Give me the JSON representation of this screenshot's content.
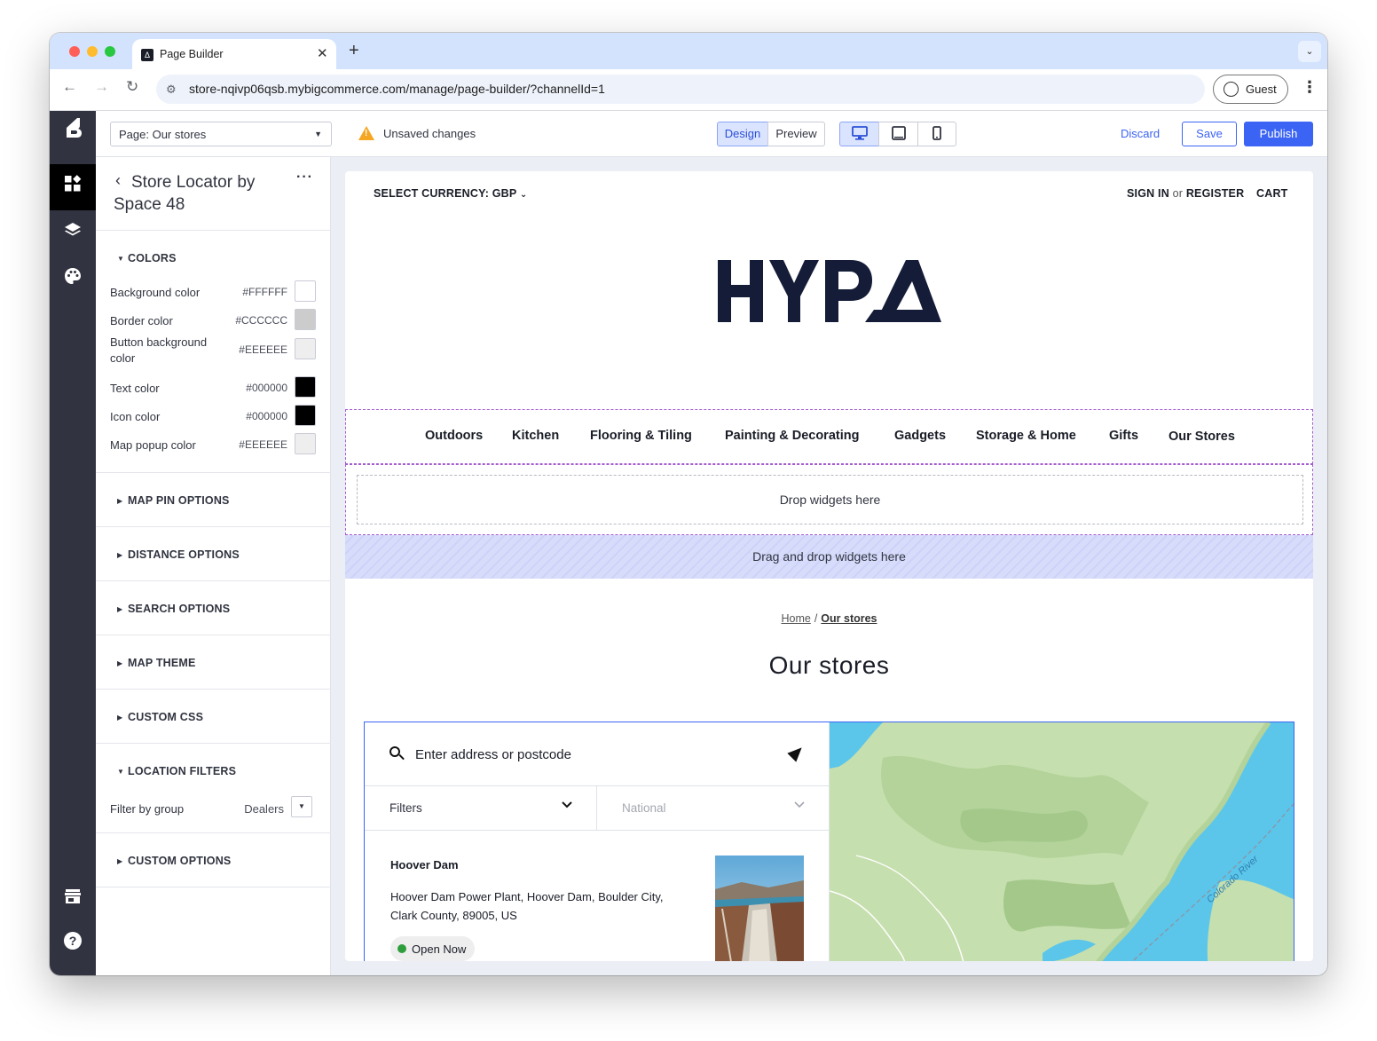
{
  "browser": {
    "tab_title": "Page Builder",
    "tab_favicon": "Δ",
    "url": "store-nqivp06qsb.mybigcommerce.com/manage/page-builder/?channelId=1",
    "profile_label": "Guest"
  },
  "rail": {
    "items": [
      {
        "icon": "bigcommerce-logo-icon"
      },
      {
        "icon": "widgets-icon",
        "active": true
      },
      {
        "icon": "layers-icon"
      },
      {
        "icon": "palette-icon"
      },
      {
        "icon": "storefront-icon"
      },
      {
        "icon": "help-icon"
      }
    ]
  },
  "topbar": {
    "page_select": "Page: Our stores",
    "unsaved_text": "Unsaved changes",
    "modes": [
      "Design",
      "Preview"
    ],
    "active_mode": "Design",
    "devices": [
      "desktop-icon",
      "tablet-icon",
      "mobile-icon"
    ],
    "discard_label": "Discard",
    "save_label": "Save",
    "publish_label": "Publish"
  },
  "panel": {
    "title": "Store Locator by Space 48",
    "more": "···",
    "colors_heading": "COLORS",
    "colors": [
      {
        "label": "Background color",
        "value": "#FFFFFF",
        "swatch": "#FFFFFF"
      },
      {
        "label": "Border color",
        "value": "#CCCCCC",
        "swatch": "#CCCCCC"
      },
      {
        "label": "Button background color",
        "value": "#EEEEEE",
        "swatch": "#EEEEEE"
      },
      {
        "label": "Text color",
        "value": "#000000",
        "swatch": "#000000"
      },
      {
        "label": "Icon color",
        "value": "#000000",
        "swatch": "#000000"
      },
      {
        "label": "Map popup color",
        "value": "#EEEEEE",
        "swatch": "#EEEEEE"
      }
    ],
    "sections": [
      "MAP PIN OPTIONS",
      "DISTANCE OPTIONS",
      "SEARCH OPTIONS",
      "MAP THEME",
      "CUSTOM CSS"
    ],
    "location_filters_heading": "LOCATION FILTERS",
    "filter_by_group_label": "Filter by group",
    "filter_by_group_value": "Dealers",
    "custom_options_heading": "CUSTOM OPTIONS"
  },
  "store": {
    "currency": "SELECT CURRENCY: GBP",
    "sign_in": "SIGN IN",
    "or": "or",
    "register": "REGISTER",
    "cart": "CART",
    "logo": "HYPA",
    "nav": [
      "Outdoors",
      "Kitchen",
      "Flooring & Tiling",
      "Painting & Decorating",
      "Gadgets",
      "Storage & Home",
      "Gifts",
      "Our Stores"
    ],
    "drop_widgets": "Drop widgets here",
    "drag_drop_widgets": "Drag and drop widgets here",
    "breadcrumb_home": "Home",
    "breadcrumb_current": "Our stores",
    "page_heading": "Our stores"
  },
  "locator": {
    "search_placeholder": "Enter address or postcode",
    "filters_label": "Filters",
    "region_label": "National",
    "store_name": "Hoover Dam",
    "store_address": "Hoover Dam Power Plant, Hoover Dam, Boulder City, Clark County, 89005, US",
    "status": "Open Now",
    "map_label": "Colorado River",
    "colors": {
      "accent": "#3C64F4",
      "open": "#2E9E3C",
      "water": "#5BC6EA",
      "land": "#C6DFAE"
    }
  }
}
